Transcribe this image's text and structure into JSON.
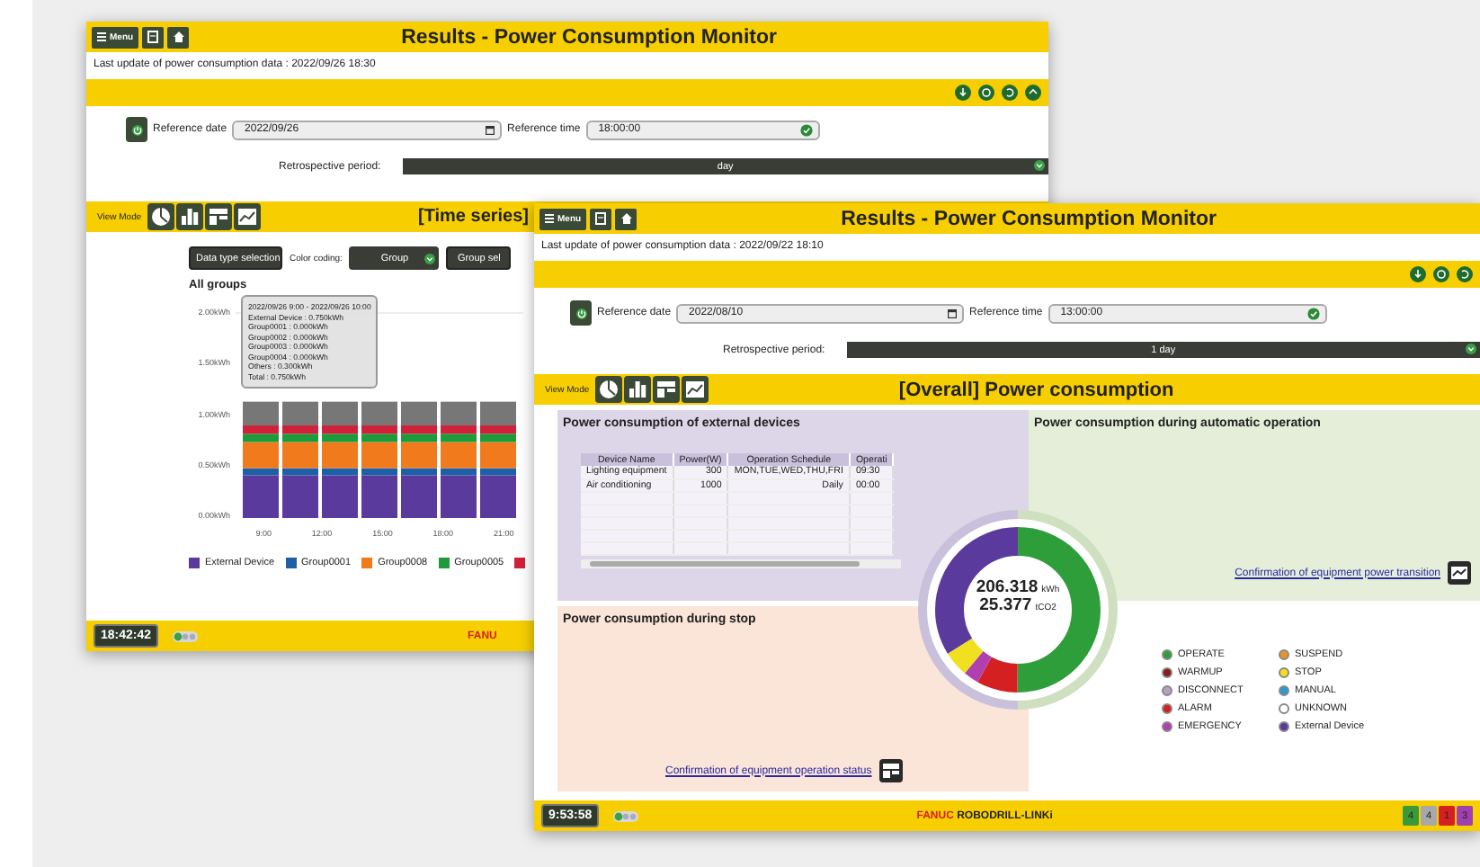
{
  "background_window": {
    "title": "Results - Power Consumption Monitor",
    "menu_button": "Menu",
    "last_update": "Last update of power consumption data : 2022/09/26 18:30",
    "reference_date_label": "Reference date",
    "reference_date": "2022/09/26",
    "reference_time_label": "Reference time",
    "reference_time": "18:00:00",
    "retrospective_label": "Retrospective period:",
    "retrospective_value": "day",
    "view_mode_label": "View Mode",
    "view_title": "[Time series]",
    "data_type_button": "Data type selection",
    "color_coding_label": "Color coding:",
    "color_coding_value": "Group",
    "group_button": "Group sel",
    "chart_title": "All groups",
    "y_labels": [
      "2.00kWh",
      "1.50kWh",
      "1.00kWh",
      "0.50kWh",
      "0.00kWh"
    ],
    "x_labels": [
      "9:00",
      "12:00",
      "15:00",
      "18:00",
      "21:00"
    ],
    "tooltip": [
      "2022/09/26 9:00 - 2022/09/26 10:00",
      "External Device : 0.750kWh",
      "Group0001 : 0.000kWh",
      "Group0002 : 0.000kWh",
      "Group0003 : 0.000kWh",
      "Group0004 : 0.000kWh",
      "Others : 0.300kWh",
      "Total : 0.750kWh"
    ],
    "legend": [
      {
        "label": "External Device",
        "color": "#5a3a9c"
      },
      {
        "label": "Group0001",
        "color": "#1f5fa8"
      },
      {
        "label": "Group0008",
        "color": "#f07a1c"
      },
      {
        "label": "Group0005",
        "color": "#1e9a3a"
      },
      {
        "color": "#d0203a"
      }
    ],
    "clock": "18:42:42",
    "footer_brand": "FANU"
  },
  "front_window": {
    "title": "Results - Power Consumption Monitor",
    "menu_button": "Menu",
    "last_update": "Last update of power consumption data : 2022/09/22 18:10",
    "reference_date_label": "Reference date",
    "reference_date": "2022/08/10",
    "reference_time_label": "Reference time",
    "reference_time": "13:00:00",
    "retrospective_label": "Retrospective period:",
    "retrospective_value": "1 day",
    "view_mode_label": "View Mode",
    "view_title": "[Overall] Power consumption",
    "external_panel": {
      "title": "Power consumption of external devices",
      "columns": [
        "Device Name",
        "Power(W)",
        "Operation Schedule",
        "Operati"
      ],
      "rows": [
        [
          "Lighting equipment",
          "300",
          "MON,TUE,WED,THU,FRI",
          "09:30"
        ],
        [
          "Air conditioning",
          "1000",
          "Daily",
          "00:00"
        ]
      ]
    },
    "automatic_panel": {
      "title": "Power consumption during automatic operation",
      "link": "Confirmation of equipment power transition"
    },
    "stop_panel": {
      "title": "Power consumption during stop",
      "link": "Confirmation of equipment operation status"
    },
    "totals": {
      "energy": "206.318",
      "energy_unit": "kWh",
      "co2": "25.377",
      "co2_unit": "tCO2"
    },
    "legend": [
      {
        "label": "OPERATE",
        "color": "#2e9e3a"
      },
      {
        "label": "SUSPEND",
        "color": "#e8932a"
      },
      {
        "label": "WARMUP",
        "color": "#8b1a1a"
      },
      {
        "label": "STOP",
        "color": "#f0e020"
      },
      {
        "label": "DISCONNECT",
        "color": "#b8a0c0"
      },
      {
        "label": "MANUAL",
        "color": "#2a9ad0"
      },
      {
        "label": "ALARM",
        "color": "#d42020"
      },
      {
        "label": "UNKNOWN",
        "color": "#ffffff"
      },
      {
        "label": "EMERGENCY",
        "color": "#b040b0"
      },
      {
        "label": "External Device",
        "color": "#5b3a9e"
      }
    ],
    "clock": "9:53:58",
    "brand_prefix": "FANUC",
    "brand_name": "ROBODRILL-LINKi",
    "status_badges": [
      {
        "count": "4",
        "color": "#3a9a3a"
      },
      {
        "count": "4",
        "color": "#a8a8a8"
      },
      {
        "count": "1",
        "color": "#d42020"
      },
      {
        "count": "3",
        "color": "#a040b0"
      }
    ]
  }
}
